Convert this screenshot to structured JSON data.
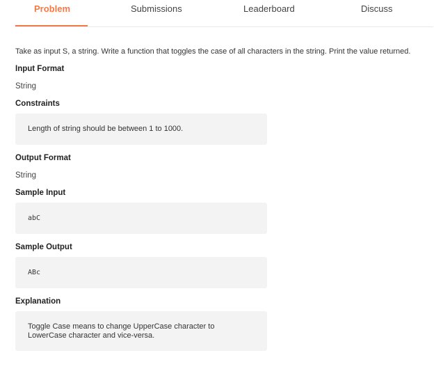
{
  "tabs": [
    {
      "label": "Problem",
      "active": true
    },
    {
      "label": "Submissions",
      "active": false
    },
    {
      "label": "Leaderboard",
      "active": false
    },
    {
      "label": "Discuss",
      "active": false
    }
  ],
  "accent_color": "#f27a49",
  "problem": {
    "description": "Take as input S, a string. Write a function that toggles the case of all characters in the string. Print the value returned.",
    "input_format_heading": "Input Format",
    "input_format": "String",
    "constraints_heading": "Constraints",
    "constraints": "Length of string should be between 1 to 1000.",
    "output_format_heading": "Output Format",
    "output_format": "String",
    "sample_input_heading": "Sample Input",
    "sample_input": "abC",
    "sample_output_heading": "Sample Output",
    "sample_output": "ABc",
    "explanation_heading": "Explanation",
    "explanation": "Toggle Case means to change UpperCase character to LowerCase character and vice-versa."
  }
}
